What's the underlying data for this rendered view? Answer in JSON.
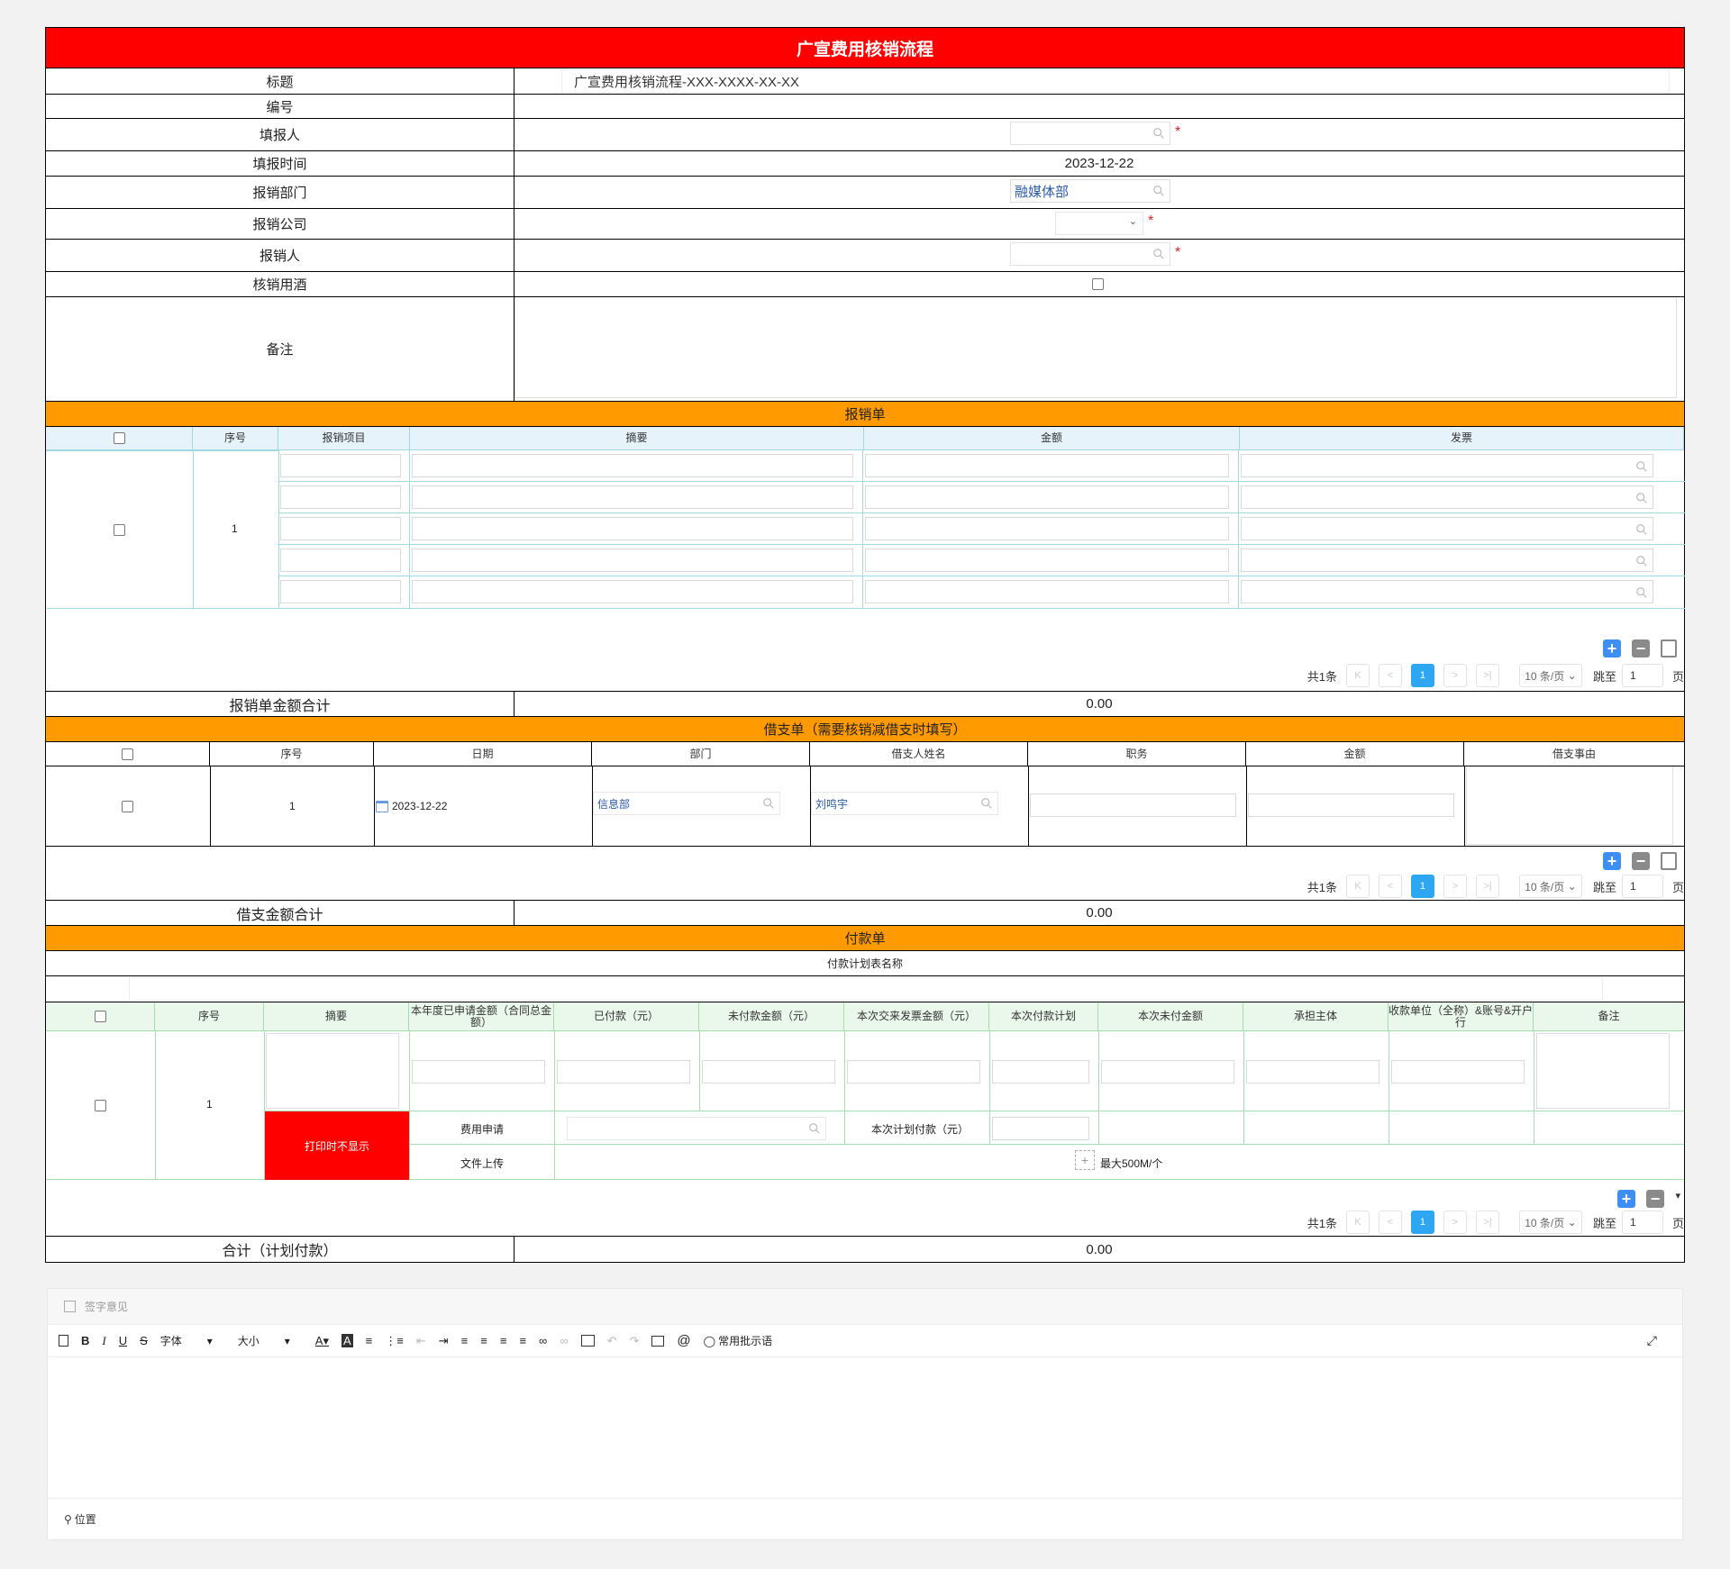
{
  "form": {
    "title": "广宣费用核销流程",
    "fields": {
      "title_label": "标题",
      "title_value": "广宣费用核销流程-XXX-XXXX-XX-XX",
      "number_label": "编号",
      "filler_label": "填报人",
      "fill_time_label": "填报时间",
      "fill_time_value": "2023-12-22",
      "dept_label": "报销部门",
      "dept_value": "融媒体部",
      "company_label": "报销公司",
      "reimburser_label": "报销人",
      "wine_label": "核销用酒",
      "remark_label": "备注"
    },
    "required_mark": "*"
  },
  "reimburse": {
    "section_title": "报销单",
    "headers": [
      "序号",
      "报销项目",
      "摘要",
      "金额",
      "发票"
    ],
    "row_index": "1",
    "pager": {
      "total": "共1条",
      "page": "1",
      "size": "10 条/页",
      "jump": "跳至",
      "jump_value": "1",
      "page_unit": "页",
      "first": "K",
      "prev": "<",
      "next": ">",
      "last": ">|"
    },
    "total_label": "报销单金额合计",
    "total_value": "0.00"
  },
  "loan": {
    "section_title": "借支单（需要核销减借支时填写）",
    "headers": [
      "序号",
      "日期",
      "部门",
      "借支人姓名",
      "职务",
      "金额",
      "借支事由"
    ],
    "row": {
      "index": "1",
      "date": "2023-12-22",
      "dept": "信息部",
      "name": "刘鸣宇"
    },
    "pager": {
      "total": "共1条",
      "page": "1",
      "size": "10 条/页",
      "jump": "跳至",
      "jump_value": "1",
      "page_unit": "页"
    },
    "total_label": "借支金额合计",
    "total_value": "0.00"
  },
  "payment": {
    "section_title": "付款单",
    "plan_name_label": "付款计划表名称",
    "headers": [
      "序号",
      "摘要",
      "本年度已申请金额（合同总金额）",
      "已付款（元）",
      "未付款金额（元）",
      "本次交来发票金额（元）",
      "本次付款计划",
      "本次未付金额",
      "承担主体",
      "收款单位（全称）&账号&开户行",
      "备注"
    ],
    "row_index": "1",
    "print_hidden": "打印时不显示",
    "fee_apply_label": "费用申请",
    "plan_pay_label": "本次计划付款（元）",
    "upload_label": "文件上传",
    "upload_hint": "最大500M/个",
    "pager": {
      "total": "共1条",
      "page": "1",
      "size": "10 条/页",
      "jump": "跳至",
      "jump_value": "1",
      "page_unit": "页"
    },
    "total_label": "合计（计划付款）",
    "total_value": "0.00"
  },
  "editor": {
    "sign_label": "签字意见",
    "font_label": "字体",
    "size_label": "大小",
    "phrases_label": "常用批示语",
    "location_label": "位置"
  },
  "colors": {
    "title_bar": "#fe0000",
    "section_bar": "#ff9a00",
    "accent_blue": "#2ea7f2",
    "required": "#e02020"
  }
}
